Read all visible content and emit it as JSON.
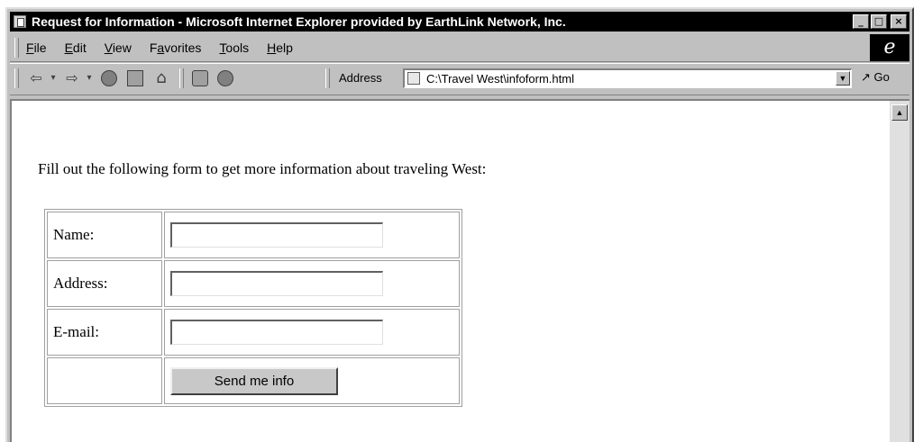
{
  "window": {
    "title": "Request for Information - Microsoft Internet Explorer provided by EarthLink Network, Inc.",
    "caption_buttons": {
      "minimize": "_",
      "maximize": "□",
      "close": "×"
    }
  },
  "menu": {
    "items": [
      {
        "label": "File",
        "accel": "F",
        "rest": "ile"
      },
      {
        "label": "Edit",
        "accel": "E",
        "rest": "dit"
      },
      {
        "label": "View",
        "accel": "V",
        "rest": "iew"
      },
      {
        "label": "Favorites",
        "pre": "F",
        "accel": "a",
        "rest": "vorites"
      },
      {
        "label": "Tools",
        "accel": "T",
        "rest": "ools"
      },
      {
        "label": "Help",
        "accel": "H",
        "rest": "elp"
      }
    ]
  },
  "toolbar": {
    "back_icon": "back-arrow-icon",
    "forward_icon": "forward-arrow-icon",
    "address_label": "Address",
    "address_value": "C:\\Travel West\\infoform.html",
    "go_label": "Go"
  },
  "page": {
    "intro": "Fill out the following form to get more information about traveling West:",
    "form": {
      "rows": [
        {
          "label": "Name:",
          "value": ""
        },
        {
          "label": "Address:",
          "value": ""
        },
        {
          "label": "E-mail:",
          "value": ""
        }
      ],
      "submit_label": "Send me info"
    }
  },
  "colors": {
    "titlebar_bg": "#000000",
    "chrome_bg": "#c0c0c0",
    "content_bg": "#ffffff"
  }
}
